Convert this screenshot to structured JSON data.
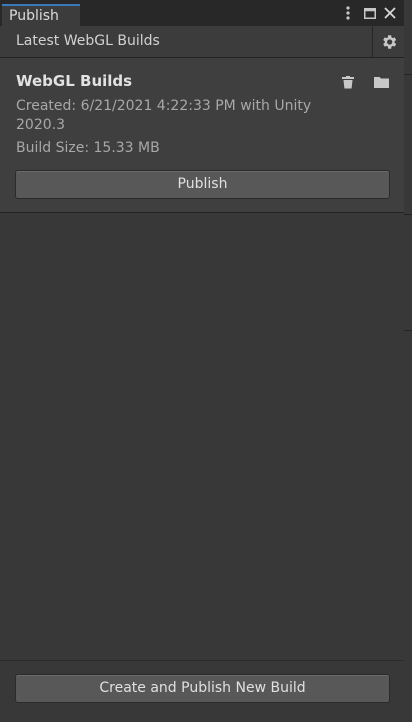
{
  "window": {
    "tab_label": "Publish",
    "menu_icon": "kebab-menu-icon",
    "maximize_icon": "maximize-icon",
    "close_icon": "close-icon"
  },
  "toolbar": {
    "title": "Latest WebGL Builds",
    "settings_icon": "gear-icon"
  },
  "build": {
    "title": "WebGL Builds",
    "created_line1": "Created: 6/21/2021 4:22:33 PM with Unity",
    "created_line2": "2020.3",
    "size": "Build Size: 15.33 MB",
    "publish_label": "Publish",
    "delete_icon": "trash-icon",
    "folder_icon": "folder-icon"
  },
  "footer": {
    "create_publish_label": "Create and Publish New Build"
  },
  "colors": {
    "panel_bg": "#383838",
    "card_bg": "#3f3f3f",
    "button_bg": "#585858",
    "tab_accent": "#3a79bb"
  }
}
